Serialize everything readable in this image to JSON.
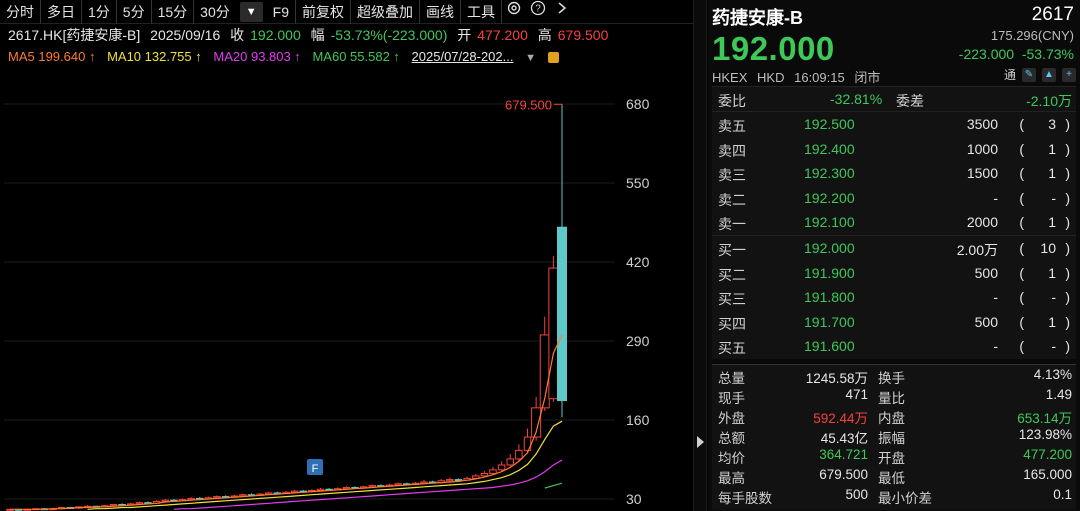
{
  "toolbar": {
    "items": [
      "分时",
      "多日",
      "1分",
      "5分",
      "15分",
      "30分",
      "▼",
      "F9",
      "前复权",
      "超级叠加",
      "画线",
      "工具"
    ]
  },
  "info": {
    "ticker": "2617.HK[药捷安康-B]",
    "date": "2025/09/16",
    "close_label": "收",
    "close": "192.000",
    "amp_label": "幅",
    "amp": "-53.73%(-223.000)",
    "open_label": "开",
    "open": "477.200",
    "high_label": "高",
    "high": "679.500"
  },
  "ma": {
    "ma5": "MA5 199.640 ↑",
    "ma10": "MA10 132.755 ↑",
    "ma20": "MA20 93.803 ↑",
    "ma60": "MA60 55.582 ↑",
    "range": "2025/07/28-202..."
  },
  "chart_data": {
    "type": "candlestick",
    "y_ticks": [
      680,
      550,
      420,
      290,
      160,
      30
    ],
    "ylim": [
      30,
      680
    ],
    "high_annotation": "679.500",
    "marker": "F",
    "candles": [
      {
        "o": 12,
        "c": 13,
        "h": 14,
        "l": 11
      },
      {
        "o": 13,
        "c": 12,
        "h": 14,
        "l": 11
      },
      {
        "o": 12,
        "c": 13,
        "h": 14,
        "l": 12
      },
      {
        "o": 13,
        "c": 14,
        "h": 15,
        "l": 12
      },
      {
        "o": 14,
        "c": 13,
        "h": 15,
        "l": 12
      },
      {
        "o": 13,
        "c": 14,
        "h": 16,
        "l": 13
      },
      {
        "o": 14,
        "c": 16,
        "h": 17,
        "l": 13
      },
      {
        "o": 16,
        "c": 15,
        "h": 17,
        "l": 14
      },
      {
        "o": 15,
        "c": 17,
        "h": 18,
        "l": 14
      },
      {
        "o": 17,
        "c": 18,
        "h": 20,
        "l": 16
      },
      {
        "o": 18,
        "c": 17,
        "h": 19,
        "l": 16
      },
      {
        "o": 17,
        "c": 19,
        "h": 20,
        "l": 16
      },
      {
        "o": 19,
        "c": 21,
        "h": 22,
        "l": 18
      },
      {
        "o": 21,
        "c": 20,
        "h": 23,
        "l": 19
      },
      {
        "o": 20,
        "c": 22,
        "h": 24,
        "l": 19
      },
      {
        "o": 22,
        "c": 24,
        "h": 26,
        "l": 21
      },
      {
        "o": 24,
        "c": 23,
        "h": 26,
        "l": 22
      },
      {
        "o": 23,
        "c": 26,
        "h": 28,
        "l": 22
      },
      {
        "o": 26,
        "c": 28,
        "h": 30,
        "l": 25
      },
      {
        "o": 28,
        "c": 27,
        "h": 30,
        "l": 25
      },
      {
        "o": 27,
        "c": 29,
        "h": 31,
        "l": 26
      },
      {
        "o": 29,
        "c": 31,
        "h": 33,
        "l": 28
      },
      {
        "o": 31,
        "c": 30,
        "h": 33,
        "l": 28
      },
      {
        "o": 30,
        "c": 32,
        "h": 34,
        "l": 29
      },
      {
        "o": 32,
        "c": 34,
        "h": 36,
        "l": 31
      },
      {
        "o": 34,
        "c": 33,
        "h": 36,
        "l": 32
      },
      {
        "o": 33,
        "c": 35,
        "h": 37,
        "l": 32
      },
      {
        "o": 35,
        "c": 37,
        "h": 39,
        "l": 34
      },
      {
        "o": 37,
        "c": 36,
        "h": 39,
        "l": 35
      },
      {
        "o": 36,
        "c": 38,
        "h": 40,
        "l": 35
      },
      {
        "o": 38,
        "c": 40,
        "h": 42,
        "l": 37
      },
      {
        "o": 40,
        "c": 39,
        "h": 42,
        "l": 38
      },
      {
        "o": 39,
        "c": 41,
        "h": 43,
        "l": 38
      },
      {
        "o": 41,
        "c": 43,
        "h": 45,
        "l": 40
      },
      {
        "o": 43,
        "c": 42,
        "h": 45,
        "l": 41
      },
      {
        "o": 42,
        "c": 44,
        "h": 46,
        "l": 41
      },
      {
        "o": 44,
        "c": 46,
        "h": 48,
        "l": 43
      },
      {
        "o": 46,
        "c": 45,
        "h": 48,
        "l": 44
      },
      {
        "o": 45,
        "c": 47,
        "h": 49,
        "l": 44
      },
      {
        "o": 47,
        "c": 49,
        "h": 51,
        "l": 46
      },
      {
        "o": 49,
        "c": 48,
        "h": 51,
        "l": 47
      },
      {
        "o": 48,
        "c": 50,
        "h": 52,
        "l": 47
      },
      {
        "o": 50,
        "c": 52,
        "h": 54,
        "l": 49
      },
      {
        "o": 52,
        "c": 51,
        "h": 54,
        "l": 50
      },
      {
        "o": 51,
        "c": 53,
        "h": 55,
        "l": 50
      },
      {
        "o": 53,
        "c": 55,
        "h": 57,
        "l": 52
      },
      {
        "o": 55,
        "c": 54,
        "h": 57,
        "l": 53
      },
      {
        "o": 54,
        "c": 56,
        "h": 58,
        "l": 53
      },
      {
        "o": 56,
        "c": 58,
        "h": 61,
        "l": 55
      },
      {
        "o": 58,
        "c": 57,
        "h": 60,
        "l": 56
      },
      {
        "o": 57,
        "c": 60,
        "h": 63,
        "l": 56
      },
      {
        "o": 60,
        "c": 62,
        "h": 65,
        "l": 59
      },
      {
        "o": 62,
        "c": 61,
        "h": 64,
        "l": 60
      },
      {
        "o": 61,
        "c": 64,
        "h": 67,
        "l": 60
      },
      {
        "o": 64,
        "c": 68,
        "h": 71,
        "l": 63
      },
      {
        "o": 68,
        "c": 72,
        "h": 76,
        "l": 66
      },
      {
        "o": 72,
        "c": 78,
        "h": 83,
        "l": 70
      },
      {
        "o": 78,
        "c": 86,
        "h": 92,
        "l": 76
      },
      {
        "o": 86,
        "c": 96,
        "h": 104,
        "l": 84
      },
      {
        "o": 96,
        "c": 110,
        "h": 120,
        "l": 92
      },
      {
        "o": 110,
        "c": 132,
        "h": 146,
        "l": 106
      },
      {
        "o": 132,
        "c": 180,
        "h": 198,
        "l": 126
      },
      {
        "o": 180,
        "c": 300,
        "h": 330,
        "l": 175
      },
      {
        "o": 195,
        "c": 410,
        "h": 430,
        "l": 190
      },
      {
        "o": 477.2,
        "c": 192,
        "h": 679.5,
        "l": 165
      }
    ],
    "ma5": [
      13,
      13,
      13,
      13,
      13,
      14,
      14,
      15,
      16,
      16,
      17,
      17,
      18,
      19,
      20,
      21,
      22,
      23,
      25,
      26,
      27,
      28,
      29,
      30,
      31,
      32,
      33,
      34,
      35,
      36,
      37,
      38,
      39,
      40,
      41,
      42,
      43,
      44,
      45,
      46,
      47,
      48,
      49,
      50,
      51,
      52,
      53,
      54,
      55,
      56,
      57,
      58,
      59,
      61,
      63,
      66,
      70,
      75,
      82,
      92,
      106,
      140,
      196,
      270,
      300
    ],
    "ma10": [
      null,
      null,
      null,
      null,
      null,
      null,
      null,
      null,
      null,
      13,
      14,
      14,
      15,
      16,
      16,
      17,
      18,
      19,
      20,
      21,
      22,
      23,
      24,
      25,
      26,
      27,
      28,
      29,
      30,
      31,
      32,
      33,
      34,
      35,
      36,
      37,
      38,
      39,
      40,
      41,
      42,
      43,
      44,
      45,
      46,
      47,
      48,
      49,
      50,
      51,
      52,
      53,
      54,
      55,
      57,
      59,
      62,
      65,
      70,
      77,
      87,
      104,
      128,
      150,
      158
    ],
    "ma20": [
      null,
      null,
      null,
      null,
      null,
      null,
      null,
      null,
      null,
      null,
      null,
      null,
      null,
      null,
      null,
      null,
      null,
      null,
      null,
      13,
      14,
      14,
      15,
      16,
      17,
      18,
      19,
      20,
      21,
      22,
      23,
      24,
      25,
      26,
      27,
      28,
      29,
      30,
      31,
      32,
      33,
      34,
      35,
      36,
      37,
      38,
      39,
      40,
      41,
      42,
      43,
      44,
      45,
      46,
      47,
      48,
      49,
      51,
      53,
      56,
      60,
      66,
      75,
      86,
      94
    ],
    "ma60": [
      null,
      null,
      null,
      null,
      null,
      null,
      null,
      null,
      null,
      null,
      null,
      null,
      null,
      null,
      null,
      null,
      null,
      null,
      null,
      null,
      null,
      null,
      null,
      null,
      null,
      null,
      null,
      null,
      null,
      null,
      null,
      null,
      null,
      null,
      null,
      null,
      null,
      null,
      null,
      null,
      null,
      null,
      null,
      null,
      null,
      null,
      null,
      null,
      null,
      null,
      null,
      null,
      null,
      null,
      null,
      null,
      null,
      null,
      null,
      null,
      null,
      null,
      48,
      52,
      56
    ]
  },
  "quote": {
    "name": "药捷安康-B",
    "code": "2617",
    "price": "192.000",
    "prev": "175.296(CNY)",
    "change": "-223.000",
    "change_pct": "-53.73%",
    "exchange": "HKEX",
    "currency": "HKD",
    "time": "16:09:15",
    "status": "闭市",
    "badge": "通"
  },
  "committee": {
    "ratio_label": "委比",
    "ratio": "-32.81%",
    "diff_label": "委差",
    "diff": "-2.10万"
  },
  "asks": [
    {
      "label": "卖五",
      "price": "192.500",
      "vol": "3500",
      "lp": "(",
      "n": "3",
      "rp": ")"
    },
    {
      "label": "卖四",
      "price": "192.400",
      "vol": "1000",
      "lp": "(",
      "n": "1",
      "rp": ")"
    },
    {
      "label": "卖三",
      "price": "192.300",
      "vol": "1500",
      "lp": "(",
      "n": "1",
      "rp": ")"
    },
    {
      "label": "卖二",
      "price": "192.200",
      "vol": "-",
      "lp": "(",
      "n": "-",
      "rp": ")"
    },
    {
      "label": "卖一",
      "price": "192.100",
      "vol": "2000",
      "lp": "(",
      "n": "1",
      "rp": ")"
    }
  ],
  "bids": [
    {
      "label": "买一",
      "price": "192.000",
      "vol": "2.00万",
      "lp": "(",
      "n": "10",
      "rp": ")"
    },
    {
      "label": "买二",
      "price": "191.900",
      "vol": "500",
      "lp": "(",
      "n": "1",
      "rp": ")"
    },
    {
      "label": "买三",
      "price": "191.800",
      "vol": "-",
      "lp": "(",
      "n": "-",
      "rp": ")"
    },
    {
      "label": "买四",
      "price": "191.700",
      "vol": "500",
      "lp": "(",
      "n": "1",
      "rp": ")"
    },
    {
      "label": "买五",
      "price": "191.600",
      "vol": "-",
      "lp": "(",
      "n": "-",
      "rp": ")"
    }
  ],
  "stats": [
    {
      "l1": "总量",
      "v1": "1245.58万",
      "c1": "w",
      "l2": "换手",
      "v2": "4.13%",
      "c2": "w"
    },
    {
      "l1": "现手",
      "v1": "471",
      "c1": "w",
      "l2": "量比",
      "v2": "1.49",
      "c2": "w"
    },
    {
      "l1": "外盘",
      "v1": "592.44万",
      "c1": "r",
      "l2": "内盘",
      "v2": "653.14万",
      "c2": "g"
    },
    {
      "l1": "总额",
      "v1": "45.43亿",
      "c1": "w",
      "l2": "振幅",
      "v2": "123.98%",
      "c2": "w"
    },
    {
      "l1": "均价",
      "v1": "364.721",
      "c1": "g",
      "l2": "开盘",
      "v2": "477.200",
      "c2": "g"
    },
    {
      "l1": "最高",
      "v1": "679.500",
      "c1": "w",
      "l2": "最低",
      "v2": "165.000",
      "c2": "w"
    },
    {
      "l1": "每手股数",
      "v1": "500",
      "c1": "w",
      "l2": "最小价差",
      "v2": "0.1",
      "c2": "w"
    }
  ],
  "colors": {
    "up": "#f5423c",
    "down": "#5fc9c9",
    "green": "#3fc85a"
  }
}
